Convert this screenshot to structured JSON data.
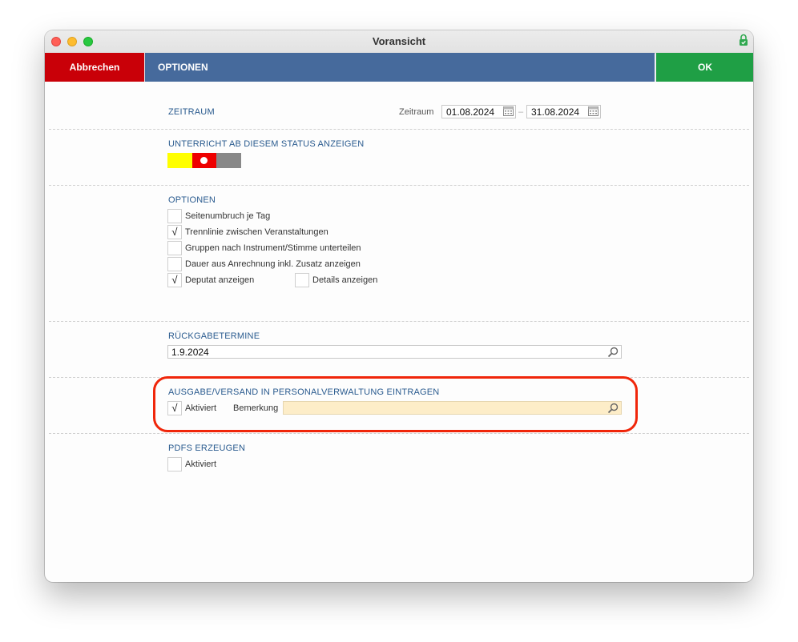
{
  "window": {
    "title": "Voransicht"
  },
  "toolbar": {
    "cancel_label": "Abbrechen",
    "options_label": "OPTIONEN",
    "ok_label": "OK"
  },
  "zeitraum": {
    "heading": "ZEITRAUM",
    "field_label": "Zeitraum",
    "from": "01.08.2024",
    "separator": "–",
    "to": "31.08.2024"
  },
  "status": {
    "heading": "UNTERRICHT AB DIESEM STATUS ANZEIGEN",
    "colors": [
      "#ffff00",
      "#ee0000",
      "#888888"
    ],
    "selected_index": 1
  },
  "optionen": {
    "heading": "OPTIONEN",
    "items": [
      {
        "label": "Seitenumbruch je Tag",
        "checked": false
      },
      {
        "label": "Trennlinie zwischen Veranstaltungen",
        "checked": true
      },
      {
        "label": "Gruppen nach Instrument/Stimme unterteilen",
        "checked": false
      },
      {
        "label": "Dauer aus Anrechnung inkl. Zusatz anzeigen",
        "checked": false
      },
      {
        "label": "Deputat anzeigen",
        "checked": true
      },
      {
        "label": "Details anzeigen",
        "checked": false
      }
    ]
  },
  "rueckgabe": {
    "heading": "RÜCKGABETERMINE",
    "value": "1.9.2024"
  },
  "ausgabe": {
    "heading": "AUSGABE/VERSAND IN PERSONALVERWALTUNG EINTRAGEN",
    "aktiviert_label": "Aktiviert",
    "aktiviert_checked": true,
    "bemerkung_label": "Bemerkung",
    "bemerkung_value": "",
    "bemerkung_bg": "#fdedc8"
  },
  "pdfs": {
    "heading": "PDFS ERZEUGEN",
    "aktiviert_label": "Aktiviert",
    "aktiviert_checked": false
  },
  "check_mark": "√"
}
